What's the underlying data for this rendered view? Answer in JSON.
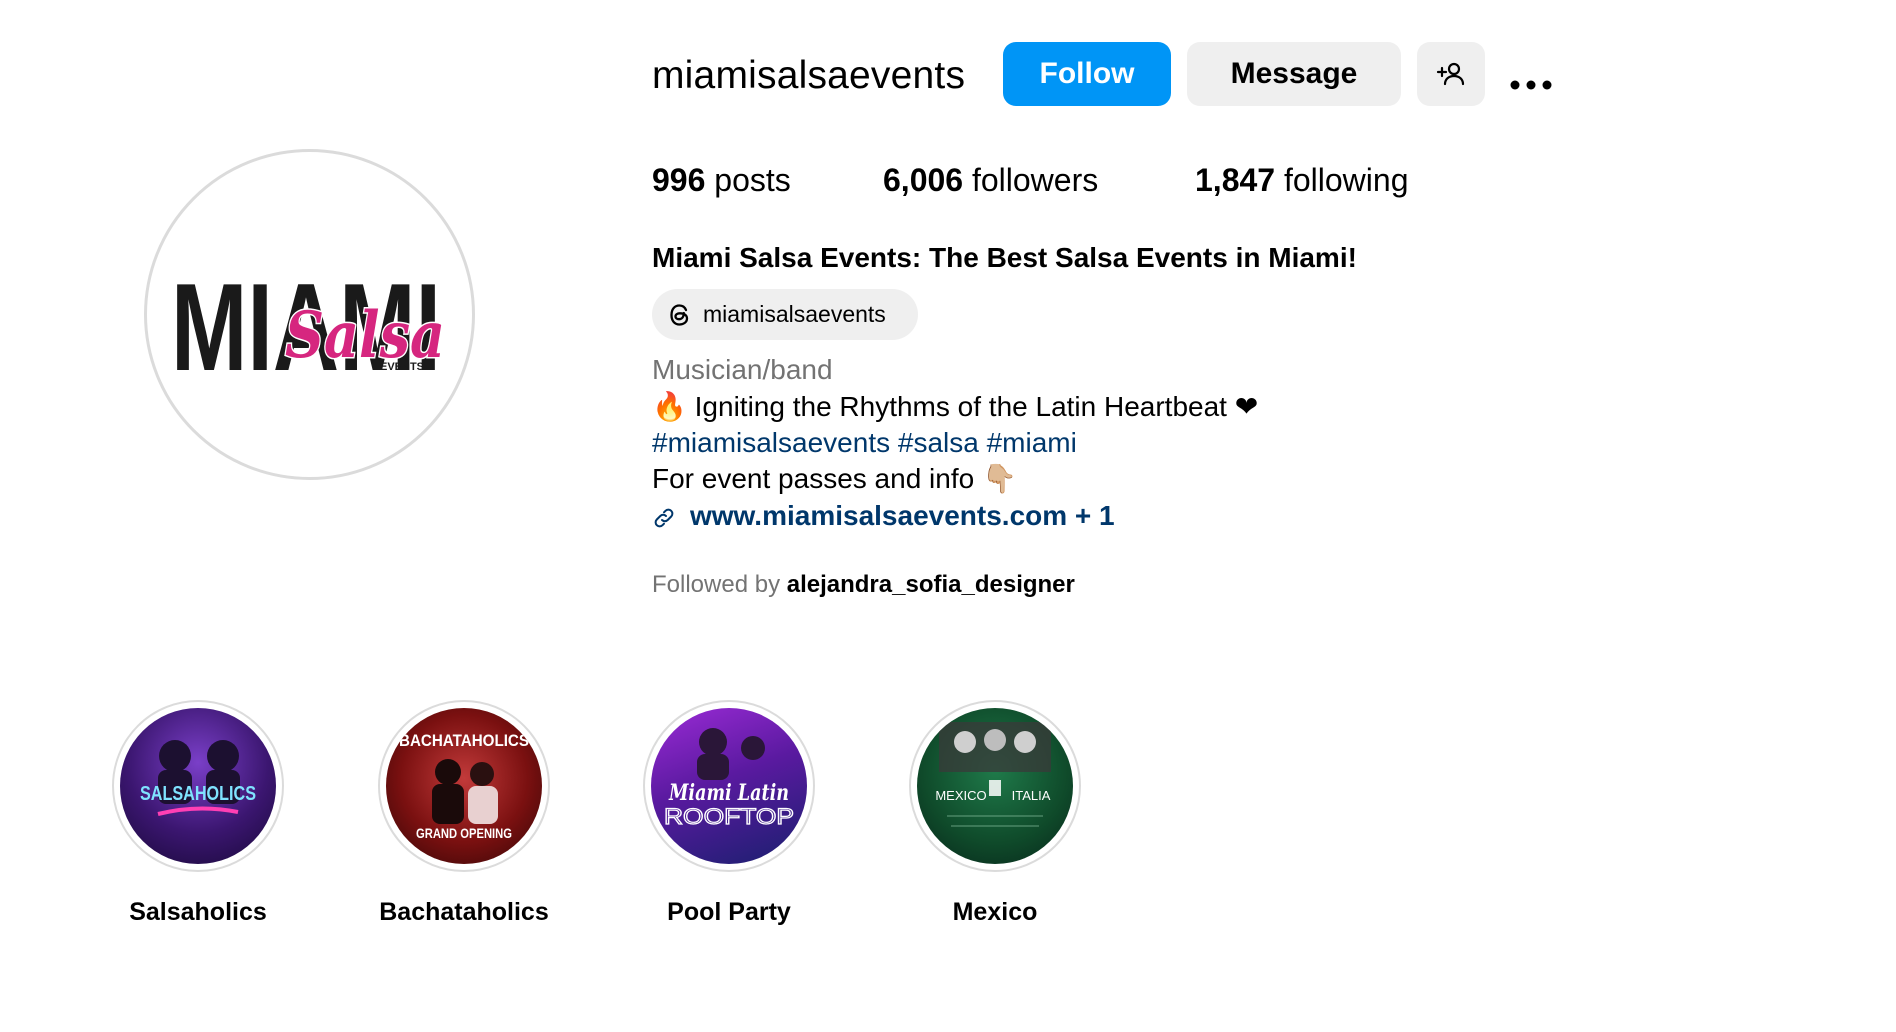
{
  "profile": {
    "username": "miamisalsaevents",
    "avatar_logo": {
      "line1": "MIAMI",
      "line2": "Salsa",
      "line3": "EVENTS"
    }
  },
  "actions": {
    "follow_label": "Follow",
    "message_label": "Message",
    "add_user_icon": "person-plus-icon",
    "more_icon": "more-horizontal-icon"
  },
  "stats": {
    "posts_count": "996",
    "posts_label": "posts",
    "followers_count": "6,006",
    "followers_label": "followers",
    "following_count": "1,847",
    "following_label": "following"
  },
  "bio": {
    "full_name": "Miami Salsa Events: The Best Salsa Events in Miami!",
    "threads_handle": "miamisalsaevents",
    "category": "Musician/band",
    "line1": "🔥 Igniting the Rhythms of the Latin Heartbeat ❤",
    "hashtags": "#miamisalsaevents #salsa #miami",
    "line3": "For event passes and info 👇🏼",
    "link": "www.miamisalsaevents.com + 1",
    "followed_by_prefix": "Followed by",
    "followed_by_user": "alejandra_sofia_designer"
  },
  "highlights": [
    {
      "label": "Salsaholics",
      "thumb_title": "SALSAHOLICS"
    },
    {
      "label": "Bachataholics",
      "thumb_title": "BACHATAHOLICS",
      "thumb_subtitle": "GRAND OPENING"
    },
    {
      "label": "Pool Party",
      "thumb_title": "Miami Latin",
      "thumb_subtitle": "ROOFTOP"
    },
    {
      "label": "Mexico",
      "thumb_title": "MEXICO",
      "thumb_subtitle": "ITALIA"
    }
  ],
  "colors": {
    "follow_button": "#0095f6",
    "secondary_button": "#efefef",
    "link": "#00376b",
    "muted_text": "#737373",
    "logo_pink": "#d6267f"
  }
}
